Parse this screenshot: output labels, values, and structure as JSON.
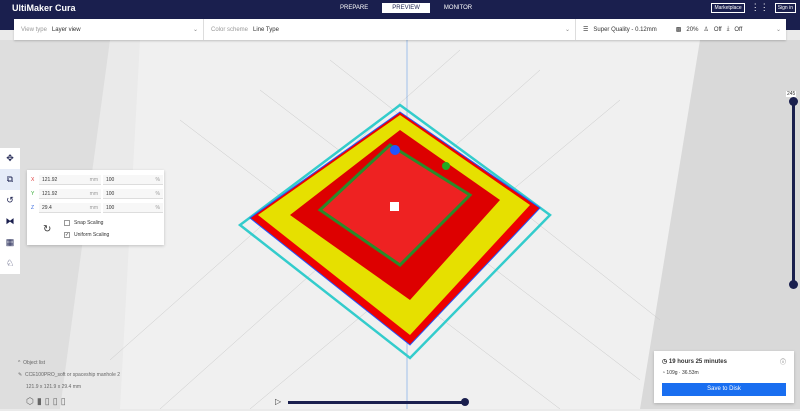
{
  "app": {
    "title": "UltiMaker Cura"
  },
  "tabs": [
    "PREPARE",
    "PREVIEW",
    "MONITOR"
  ],
  "top_right": {
    "marketplace": "Marketplace",
    "sign_in": "Sign in"
  },
  "toolbar": {
    "view_type_label": "View type",
    "view_type": "Layer view",
    "color_scheme_label": "Color scheme",
    "color_scheme": "Line Type",
    "profile": "Super Quality - 0.12mm",
    "infill": "20%",
    "support": "Off",
    "adhesion": "Off"
  },
  "scale": {
    "rows": [
      {
        "axis": "X",
        "mm": "121.92",
        "pct": "100"
      },
      {
        "axis": "Y",
        "mm": "121.92",
        "pct": "100"
      },
      {
        "axis": "Z",
        "mm": "29.4",
        "pct": "100"
      }
    ],
    "unit_mm": "mm",
    "unit_pct": "%",
    "snap": "Snap Scaling",
    "uniform": "Uniform Scaling"
  },
  "layer": {
    "current": "245"
  },
  "object_list": {
    "header": "Object list",
    "name": "CCE100PRO_soft  or  spaceship  manhole 2",
    "dims": "121.9 x 121.9 x 29.4 mm"
  },
  "estimate": {
    "time": "19 hours 25 minutes",
    "material": "109g · 36.53m",
    "save": "Save to Disk"
  }
}
